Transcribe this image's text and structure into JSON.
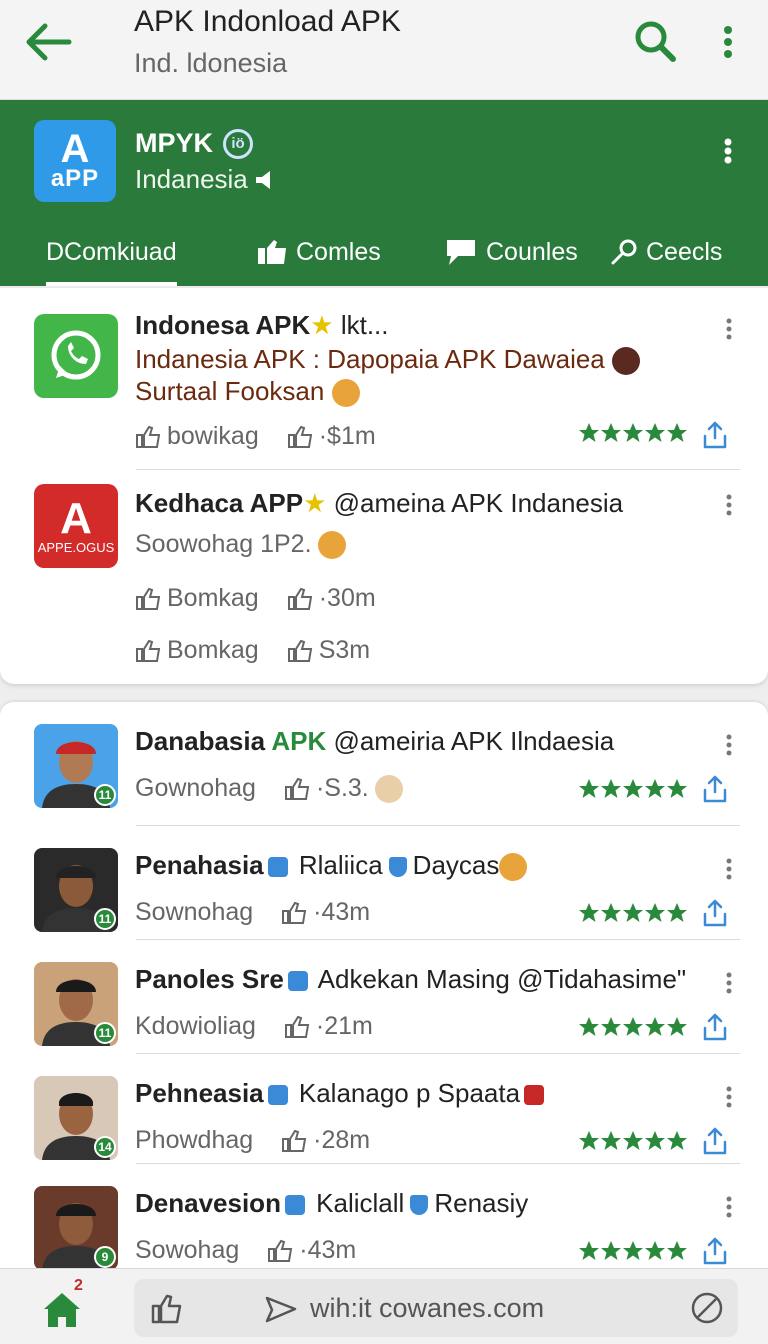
{
  "appbar": {
    "title": "APK Indonload APK",
    "subtitle": "Ind. ldonesia",
    "back_icon": "arrow-left-icon",
    "search_icon": "search-icon",
    "more_icon": "more-vertical-icon"
  },
  "profile": {
    "logo_line1": "A",
    "logo_line2": "aPP",
    "name": "MPYK",
    "badge": "iö",
    "region": "Indanesia",
    "region_icon": "speaker-icon"
  },
  "tabs": [
    {
      "label": "DComkiuad",
      "active": true
    },
    {
      "label": "Comles",
      "icon": "thumbs-icon"
    },
    {
      "label": "Counles",
      "icon": "chat-icon"
    },
    {
      "label": "Ceecls",
      "icon": "key-icon"
    }
  ],
  "card1": [
    {
      "title_bold": "Indonesa APK",
      "title_rest": " lkt...",
      "line2": "Indanesia APK : Dapopaia APK Dawaiea",
      "line3": "Surtaal Fooksan",
      "meta_a": "bowikag",
      "meta_b": "·$1m",
      "rating_stars": 5,
      "icon": "whatsapp-icon"
    },
    {
      "title_bold": "Kedhaca APP",
      "title_rest": " @ameina APK Indanesia",
      "line2": "Soowohag  1P2.",
      "meta_rows": [
        {
          "a": "Bomkag",
          "b": "·30m"
        },
        {
          "a": "Bomkag",
          "b": "S3m"
        }
      ],
      "logo_big": "A",
      "logo_small": "APPE.OGUS"
    }
  ],
  "card2": [
    {
      "title_bold": "Danabasia",
      "title_green": "APK",
      "title_rest": " @ameiria APK Ilndaesia",
      "meta_a": "Gownohag",
      "meta_b": "·S.3.",
      "rating_stars": 5,
      "badge": "11"
    },
    {
      "title_bold": "Penahasia",
      "title_rest": " Rlaliica",
      "title_tail": " Daycas",
      "meta_a": "Sownohag",
      "meta_b": "·43m",
      "rating_stars": 5,
      "badge": "11"
    },
    {
      "title_bold": "Panoles Sre",
      "title_rest": " Adkekan Masing @Tidahasime\"",
      "meta_a": "Kdowioliag",
      "meta_b": "·21m",
      "rating_stars": 5,
      "badge": "11"
    },
    {
      "title_bold": "Pehneasia",
      "title_rest": " Kalanago p Spaata",
      "meta_a": "Phowdhag",
      "meta_b": "·28m",
      "rating_stars": 5,
      "badge": "14"
    },
    {
      "title_bold": "Denavesion",
      "title_rest": " Kaliclall",
      "title_tail": " Renasiy",
      "meta_a": "Sowohag",
      "meta_b": "·43m",
      "rating_stars": 5,
      "badge": "9"
    }
  ],
  "bottombar": {
    "home_icon": "home-icon",
    "home_badge": "2",
    "like_icon": "thumbs-up-icon",
    "send_icon": "send-icon",
    "url": "wih:it cowanes.com",
    "block_icon": "block-icon"
  },
  "colors": {
    "accent_green": "#2a7a3c",
    "star_green": "#2a8a3c",
    "share_blue": "#3a8ad8"
  }
}
